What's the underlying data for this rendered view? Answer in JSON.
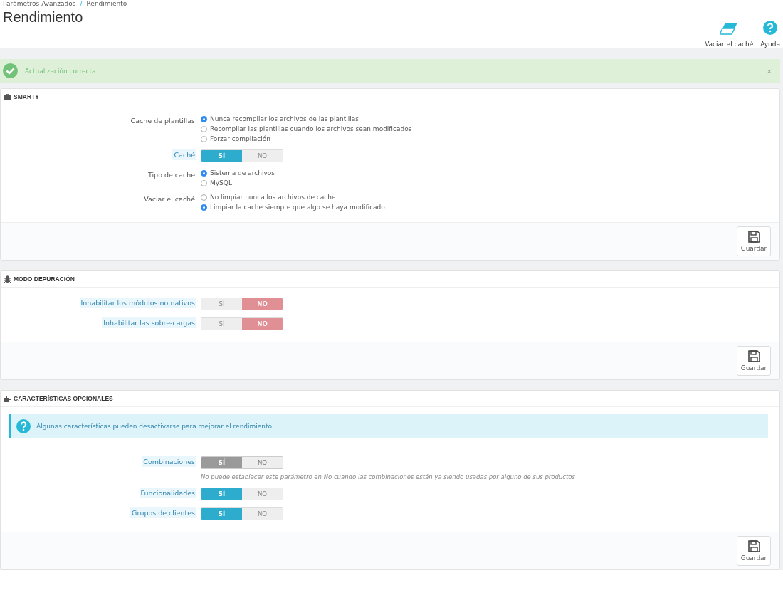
{
  "breadcrumb": [
    "Parámetros Avanzados",
    "Rendimiento"
  ],
  "breadcrumb_separator": "/",
  "title": "Rendimiento",
  "toolbar": [
    {
      "kind": "eraser",
      "label": "Vaciar el caché"
    },
    {
      "kind": "help",
      "label": "Ayuda"
    }
  ],
  "alert": {
    "text": "Actualización correcta",
    "close": "×"
  },
  "panels": [
    {
      "kind": "briefcase",
      "title": "SMARTY",
      "fields": [
        {
          "kind": "radio",
          "label": "Cache de plantillas",
          "tooltip": false,
          "options": [
            {
              "label": "Nunca recompilar los archivos de las plantillas",
              "selected": true
            },
            {
              "label": "Recompilar las plantillas cuando los archivos sean modificados",
              "selected": false
            },
            {
              "label": "Forzar compilación",
              "selected": false
            }
          ]
        },
        {
          "kind": "switch",
          "label": "Caché",
          "tooltip": true,
          "options": [
            {
              "label": "SÍ",
              "selected": true
            },
            {
              "label": "NO",
              "selected": false
            }
          ]
        },
        {
          "kind": "radio",
          "label": "Tipo de cache",
          "tooltip": false,
          "options": [
            {
              "label": "Sistema de archivos",
              "selected": true
            },
            {
              "label": "MySQL",
              "selected": false
            }
          ]
        },
        {
          "kind": "radio",
          "label": "Vaciar el caché",
          "tooltip": false,
          "options": [
            {
              "label": "No limpiar nunca los archivos de cache",
              "selected": false
            },
            {
              "label": "Limpiar la cache siempre que algo se haya modificado",
              "selected": true
            }
          ]
        }
      ],
      "save": "Guardar"
    },
    {
      "kind": "bug",
      "title": "MODO DEPURACIÓN",
      "fields": [
        {
          "kind": "switch",
          "label": "Inhabilitar los módulos no nativos",
          "tooltip": true,
          "options": [
            {
              "label": "SÍ",
              "selected": false
            },
            {
              "label": "NO",
              "selected": true
            }
          ]
        },
        {
          "kind": "switch",
          "label": "Inhabilitar las sobre-cargas",
          "tooltip": true,
          "options": [
            {
              "label": "SÍ",
              "selected": false
            },
            {
              "label": "NO",
              "selected": true
            }
          ]
        }
      ],
      "save": "Guardar"
    },
    {
      "kind": "puzzle",
      "title": "CARACTERÍSTICAS OPCIONALES",
      "info": "Algunas características pueden desactivarse para mejorar el rendimiento.",
      "fields": [
        {
          "kind": "switch",
          "label": "Combinaciones",
          "tooltip": true,
          "disabled": true,
          "help": "No puede establecer este parámetro en No cuando las combinaciones están ya siendo usadas por alguno de sus productos",
          "options": [
            {
              "label": "SÍ",
              "selected": true
            },
            {
              "label": "NO",
              "selected": false
            }
          ]
        },
        {
          "kind": "switch",
          "label": "Funcionalidades",
          "tooltip": true,
          "options": [
            {
              "label": "SÍ",
              "selected": true
            },
            {
              "label": "NO",
              "selected": false
            }
          ]
        },
        {
          "kind": "switch",
          "label": "Grupos de clientes",
          "tooltip": true,
          "options": [
            {
              "label": "SÍ",
              "selected": true
            },
            {
              "label": "NO",
              "selected": false
            }
          ]
        }
      ],
      "save": "Guardar"
    }
  ]
}
